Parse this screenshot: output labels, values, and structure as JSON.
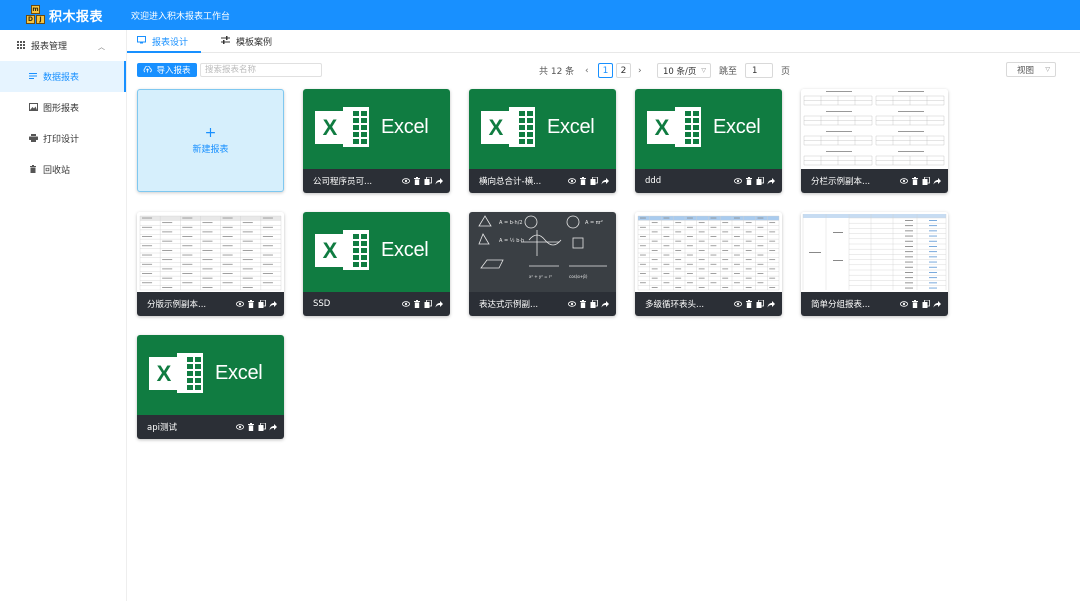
{
  "header": {
    "logo_text": "积木报表",
    "logo_blocks": [
      "m",
      "D",
      "J",
      "f"
    ],
    "welcome": "欢迎进入积木报表工作台",
    "bg_color": "#1890ff"
  },
  "sidebar": {
    "group": {
      "label": "报表管理",
      "icon": "grid-icon"
    },
    "items": [
      {
        "label": "数据报表",
        "icon": "list-icon",
        "active": true
      },
      {
        "label": "图形报表",
        "icon": "image-icon",
        "active": false
      },
      {
        "label": "打印设计",
        "icon": "printer-icon",
        "active": false
      },
      {
        "label": "回收站",
        "icon": "trash-icon",
        "active": false
      }
    ]
  },
  "tabs": [
    {
      "label": "报表设计",
      "icon": "monitor-icon",
      "active": true
    },
    {
      "label": "模板案例",
      "icon": "sliders-icon",
      "active": false
    }
  ],
  "toolbar": {
    "import_label": "导入报表",
    "search_placeholder": "搜索报表名称"
  },
  "pagination": {
    "total_text": "共 12 条",
    "pages": [
      "1",
      "2"
    ],
    "current_page": "1",
    "page_size": "10 条/页",
    "jump_label": "跳至",
    "jump_value": "1",
    "page_suffix": "页",
    "view_label": "视图"
  },
  "new_card": {
    "label": "新建报表"
  },
  "cards": [
    {
      "title": "公司程序员可...",
      "thumb": "excel"
    },
    {
      "title": "横向总合计-横...",
      "thumb": "excel"
    },
    {
      "title": "ddd",
      "thumb": "excel"
    },
    {
      "title": "分栏示例副本...",
      "thumb": "columns-sheet"
    },
    {
      "title": "分版示例副本...",
      "thumb": "table-sheet"
    },
    {
      "title": "SSD",
      "thumb": "excel"
    },
    {
      "title": "表达式示例副...",
      "thumb": "chalkboard"
    },
    {
      "title": "多级循环表头...",
      "thumb": "multi-header-sheet"
    },
    {
      "title": "简单分组报表...",
      "thumb": "group-sheet"
    },
    {
      "title": "api测试",
      "thumb": "excel"
    }
  ],
  "excel_word": "Excel",
  "colors": {
    "accent": "#1890ff",
    "excel_green": "#107c41",
    "card_footer": "#2b2f36"
  }
}
